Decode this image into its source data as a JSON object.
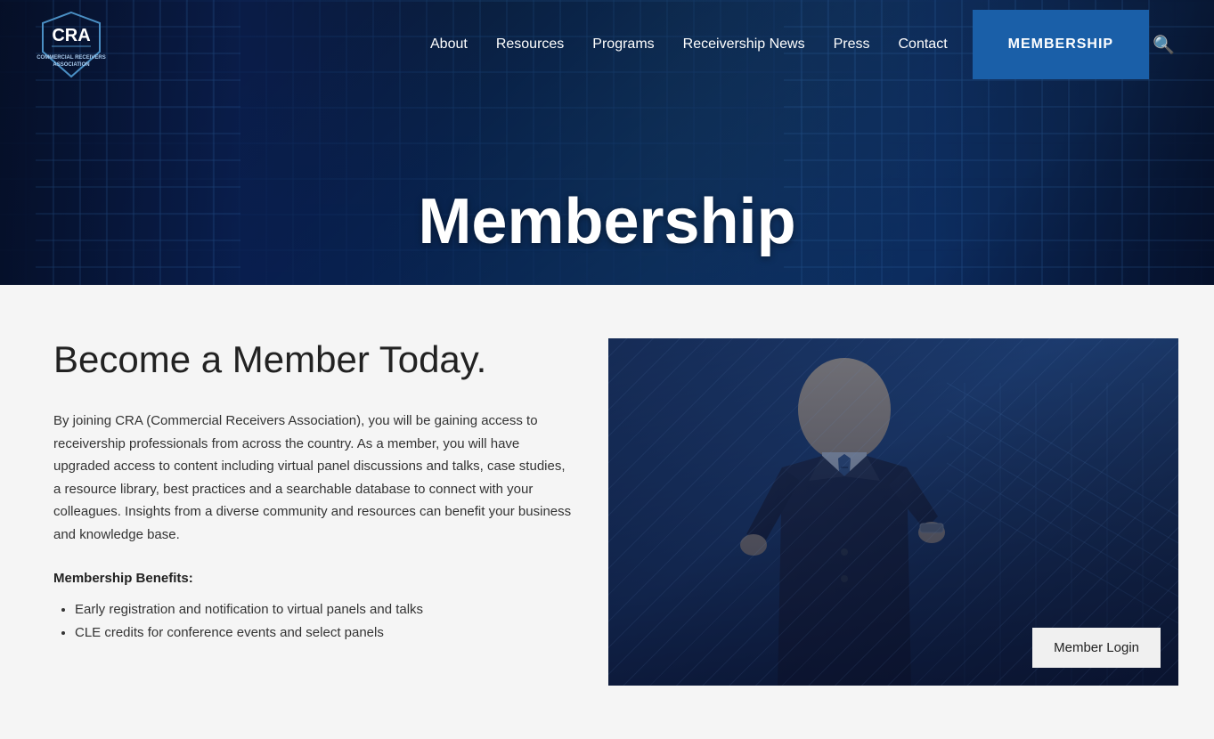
{
  "site": {
    "title": "CRA - Commercial Receivers Association"
  },
  "header": {
    "logo_alt": "CRA Commercial Receivers Association",
    "logo_line1": "COMMERCIAL",
    "logo_line2": "RECEIVERS",
    "logo_line3": "ASSOCIATION",
    "nav": [
      {
        "label": "About",
        "href": "#"
      },
      {
        "label": "Resources",
        "href": "#"
      },
      {
        "label": "Programs",
        "href": "#"
      },
      {
        "label": "Receivership News",
        "href": "#"
      },
      {
        "label": "Press",
        "href": "#"
      },
      {
        "label": "Contact",
        "href": "#"
      }
    ],
    "membership_btn": "MEMBERSHIP",
    "search_icon": "🔍"
  },
  "hero": {
    "title": "Membership"
  },
  "main": {
    "section_title": "Become a Member Today.",
    "body_text": "By joining CRA (Commercial Receivers Association), you will be gaining access to receivership professionals from across the country. As a member, you will have upgraded access to content including virtual panel discussions and talks, case studies, a resource library, best practices and a searchable database to connect with your colleagues.  Insights from a diverse community and resources can benefit your business and knowledge base.",
    "benefits_label": "Membership Benefits:",
    "benefits": [
      "Early registration and notification to virtual panels and talks",
      "CLE credits for conference events and select panels"
    ],
    "member_login_btn": "Member Login"
  }
}
